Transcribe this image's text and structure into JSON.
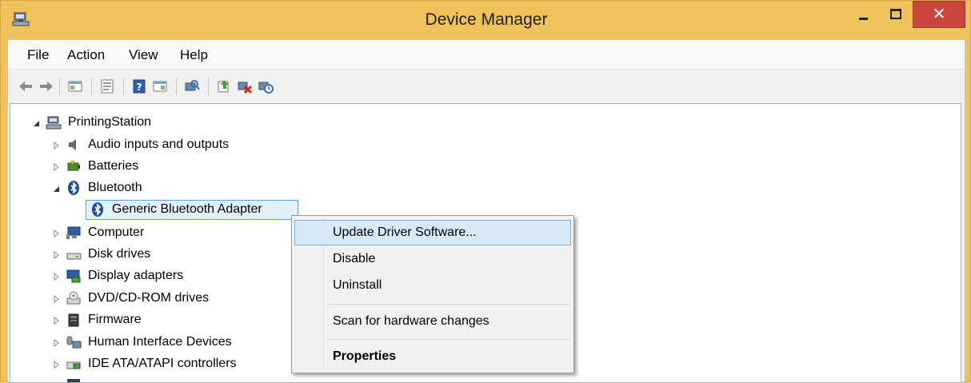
{
  "window": {
    "title": "Device Manager",
    "close_glyph": "✕",
    "colors": {
      "title_bar": "#f0c25c",
      "close_button": "#c9463d",
      "selection": "#e5f1fb",
      "menu_hover": "#d7e8f7"
    }
  },
  "menubar": {
    "items": [
      "File",
      "Action",
      "View",
      "Help"
    ]
  },
  "toolbar": {
    "icons": [
      "back-icon",
      "forward-icon",
      "show-hide-console-tree-icon",
      "properties-icon",
      "help-icon",
      "show-hide-action-pane-icon",
      "scan-hardware-icon",
      "update-driver-icon",
      "uninstall-icon",
      "rollback-icon"
    ]
  },
  "tree": {
    "root": {
      "label": "PrintingStation",
      "icon": "computer-node-icon"
    },
    "categories": [
      {
        "label": "Audio inputs and outputs",
        "icon": "speaker-icon",
        "expanded": false
      },
      {
        "label": "Batteries",
        "icon": "battery-icon",
        "expanded": false
      },
      {
        "label": "Bluetooth",
        "icon": "bluetooth-icon",
        "expanded": true,
        "children": [
          {
            "label": "Generic Bluetooth Adapter",
            "icon": "bluetooth-icon",
            "selected": true
          }
        ]
      },
      {
        "label": "Computer",
        "icon": "monitor-icon",
        "expanded": false
      },
      {
        "label": "Disk drives",
        "icon": "disk-drive-icon",
        "expanded": false
      },
      {
        "label": "Display adapters",
        "icon": "display-adapter-icon",
        "expanded": false
      },
      {
        "label": "DVD/CD-ROM drives",
        "icon": "dvd-drive-icon",
        "expanded": false
      },
      {
        "label": "Firmware",
        "icon": "firmware-icon",
        "expanded": false
      },
      {
        "label": "Human Interface Devices",
        "icon": "hid-icon",
        "expanded": false
      },
      {
        "label": "IDE ATA/ATAPI controllers",
        "icon": "ide-controller-icon",
        "expanded": false
      }
    ]
  },
  "context_menu": {
    "items": [
      {
        "label": "Update Driver Software...",
        "highlighted": true
      },
      {
        "label": "Disable"
      },
      {
        "label": "Uninstall"
      },
      {
        "label": "Scan for hardware changes"
      },
      {
        "label": "Properties",
        "bold": true
      }
    ]
  }
}
